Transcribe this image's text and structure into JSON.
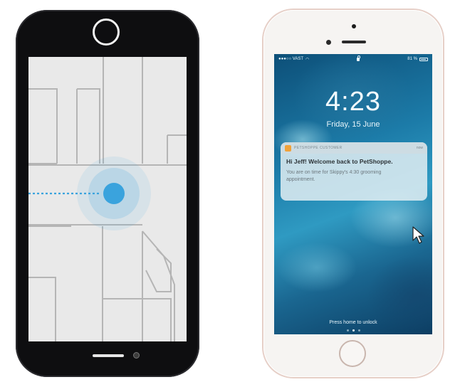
{
  "left_phone": {
    "screen": "indoor-map",
    "location_marker": "blue-location-dot"
  },
  "right_phone": {
    "status_bar": {
      "carrier": "●●●○○ VAST",
      "battery": "81 %"
    },
    "lock_screen": {
      "time": "4:23",
      "date": "Friday, 15 June",
      "unlock_hint": "Press home to unlock"
    },
    "notification": {
      "app_name": "PETSHOPPE CUSTOMER",
      "time": "now",
      "title": "Hi Jeff! Welcome back to PetShoppe.",
      "body": "You are on time for Skippy's 4:30 grooming appointment."
    }
  },
  "colors": {
    "map_background": "#e9e9e9",
    "map_lines": "#b5b5b5",
    "location_blue": "#3aa3dd",
    "wallpaper_teal": "#1c7ba8",
    "notification_icon": "#f0a23a"
  }
}
